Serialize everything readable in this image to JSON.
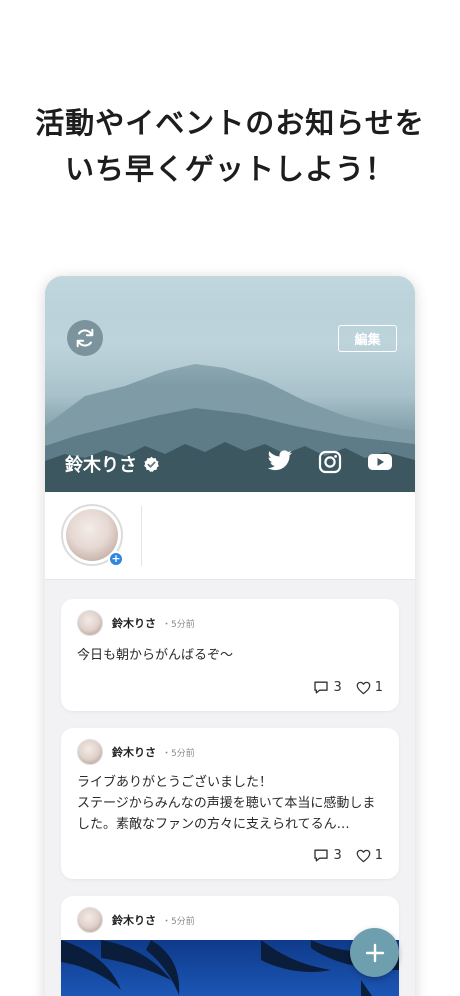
{
  "headline": {
    "line1": "活動やイベントのお知らせを",
    "line2": "いち早くゲットしよう！"
  },
  "profile": {
    "name": "鈴木りさ",
    "edit_label": "編集",
    "verified_icon": "verified-badge-icon"
  },
  "social_icons": [
    "twitter-icon",
    "instagram-icon",
    "youtube-icon"
  ],
  "posts": [
    {
      "author": "鈴木りさ",
      "time": "・5分前",
      "text": "今日も朝からがんばるぞ〜",
      "comments": "3",
      "likes": "1"
    },
    {
      "author": "鈴木りさ",
      "time": "・5分前",
      "text": "ライブありがとうございました！\nステージからみんなの声援を聴いて本当に感動しました。素敵なファンの方々に支えられてるん…",
      "comments": "3",
      "likes": "1"
    },
    {
      "author": "鈴木りさ",
      "time": "・5分前"
    }
  ],
  "fab_icon": "plus-icon",
  "colors": {
    "accent_blue": "#2f86e0",
    "fab": "#6e9fae",
    "card_bg": "#ffffff",
    "feed_bg": "#f2f2f4"
  }
}
